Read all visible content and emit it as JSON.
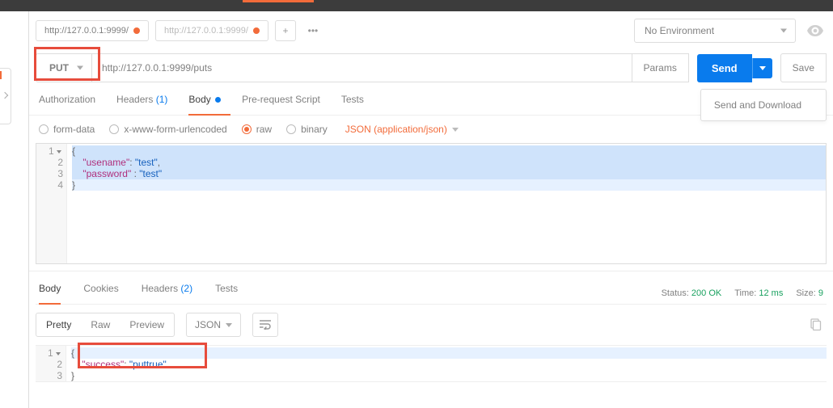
{
  "top": {
    "env": "No Environment",
    "tabs": [
      {
        "label": "http://127.0.0.1:9999/",
        "modified": true,
        "active": true
      },
      {
        "label": "http://127.0.0.1:9999/",
        "modified": true,
        "active": false
      }
    ]
  },
  "request": {
    "method": "PUT",
    "url": "http://127.0.0.1:9999/puts",
    "params_btn": "Params",
    "send_btn": "Send",
    "save_btn": "Save",
    "send_dropdown_item": "Send and Download"
  },
  "req_tabs": {
    "authorization": "Authorization",
    "headers": "Headers",
    "headers_count": "(1)",
    "body": "Body",
    "pre": "Pre-request Script",
    "tests": "Tests",
    "cookies": "Cookies"
  },
  "body_types": {
    "form": "form-data",
    "xwww": "x-www-form-urlencoded",
    "raw": "raw",
    "binary": "binary",
    "content_type": "JSON (application/json)"
  },
  "request_body": {
    "l1": "{",
    "l2_key": "\"usename\"",
    "l2_val": "\"test\"",
    "l3_key": "\"password\"",
    "l3_val": "\"test\"",
    "l4": "}"
  },
  "resp_tabs": {
    "body": "Body",
    "cookies": "Cookies",
    "headers": "Headers",
    "headers_count": "(2)",
    "tests": "Tests"
  },
  "resp_meta": {
    "status_lbl": "Status:",
    "status_val": "200 OK",
    "time_lbl": "Time:",
    "time_val": "12 ms",
    "size_lbl": "Size:",
    "size_val": "9"
  },
  "resp_tb": {
    "pretty": "Pretty",
    "raw": "Raw",
    "preview": "Preview",
    "fmt": "JSON"
  },
  "response_body": {
    "l1": "{",
    "l2_key": "\"success\"",
    "l2_val": "\"puttrue\"",
    "l3": "}"
  }
}
